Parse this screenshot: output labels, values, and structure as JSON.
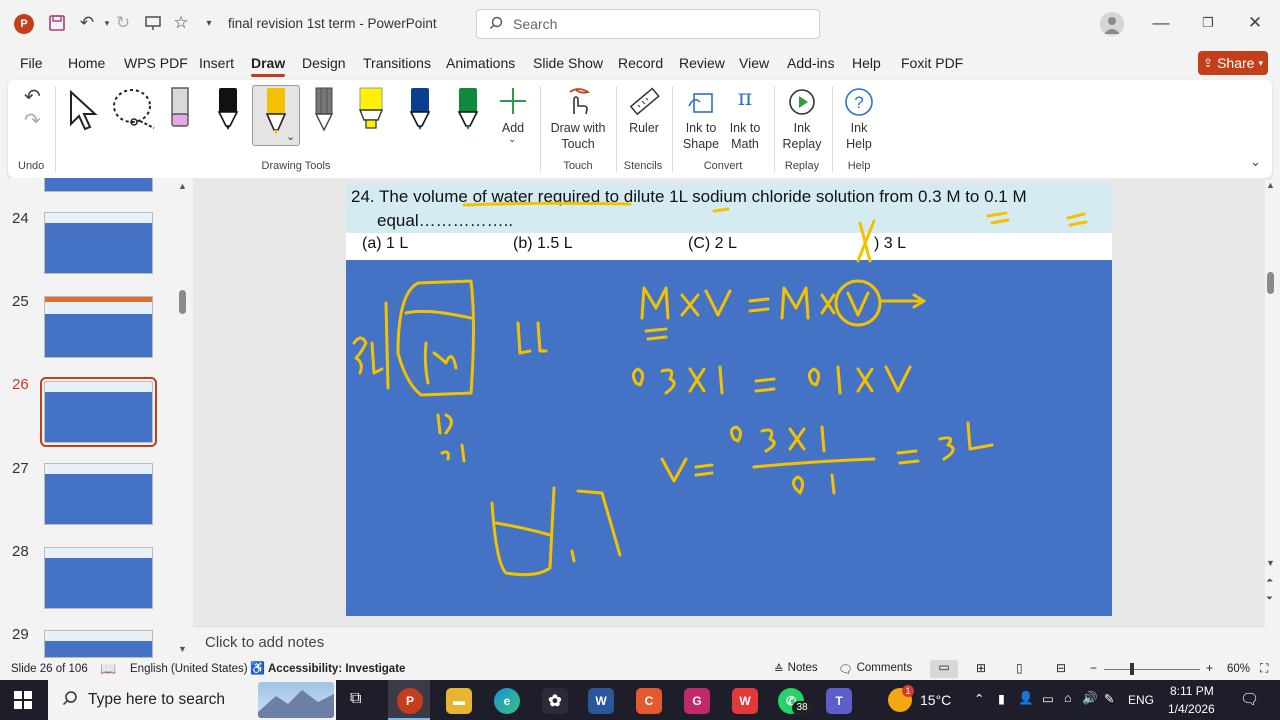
{
  "window": {
    "title": "final revision 1st term  -  PowerPoint",
    "search_placeholder": "Search"
  },
  "menu": {
    "tabs": [
      "File",
      "Home",
      "WPS PDF",
      "Insert",
      "Draw",
      "Design",
      "Transitions",
      "Animations",
      "Slide Show",
      "Record",
      "Review",
      "View",
      "Add-ins",
      "Help",
      "Foxit PDF"
    ],
    "active": "Draw",
    "share_label": "Share"
  },
  "ribbon": {
    "groups": {
      "undo": "Undo",
      "drawing_tools": "Drawing Tools",
      "touch": "Touch",
      "stencils": "Stencils",
      "convert": "Convert",
      "replay": "Replay",
      "help": "Help"
    },
    "buttons": {
      "add": "Add",
      "draw_with_touch_1": "Draw with",
      "draw_with_touch_2": "Touch",
      "ruler": "Ruler",
      "ink_to_shape_1": "Ink to",
      "ink_to_shape_2": "Shape",
      "ink_to_math_1": "Ink to",
      "ink_to_math_2": "Math",
      "ink_replay_1": "Ink",
      "ink_replay_2": "Replay",
      "ink_help_1": "Ink",
      "ink_help_2": "Help"
    },
    "colors": {
      "pen_black": "#111111",
      "pen_yellow": "#f2c200",
      "pen_gray": "#777777",
      "highlighter_yellow": "#fff200",
      "pen_blue": "#0b3d91",
      "pen_green": "#0f8a3c"
    }
  },
  "thumbnails": {
    "items": [
      {
        "num": "24",
        "selected": false
      },
      {
        "num": "25",
        "selected": false
      },
      {
        "num": "26",
        "selected": true
      },
      {
        "num": "27",
        "selected": false
      },
      {
        "num": "28",
        "selected": false
      },
      {
        "num": "29",
        "selected": false
      }
    ]
  },
  "slide": {
    "question_line1": "24. The volume of water required to dilute 1L sodium chloride solution from 0.3 M to 0.1 M",
    "question_line2": "equal……………..",
    "options": [
      "(a) 1 L",
      "(b) 1.5 L",
      "(C) 2 L",
      ") 3 L"
    ],
    "ink": {
      "eq1": "M x V = M x V",
      "eq2": "0.3 x 1 = 0.1 x V",
      "eq3": "V = 0.3 x 1 / 0.1 = 3L"
    }
  },
  "notes_placeholder": "Click to add notes",
  "status": {
    "slide_info": "Slide 26 of 106",
    "language": "English (United States)",
    "accessibility": "Accessibility: Investigate",
    "notes": "Notes",
    "comments": "Comments",
    "zoom": "60%"
  },
  "taskbar": {
    "search_placeholder": "Type here to search",
    "weather": "15°C",
    "language": "ENG",
    "time": "8:11 PM",
    "date": "1/4/2026",
    "whatsapp_badge": "38",
    "weather_badge": "1"
  },
  "accent": "#c43e1c",
  "slide_bg": "#4472c4",
  "ink_color": "#f2c200"
}
